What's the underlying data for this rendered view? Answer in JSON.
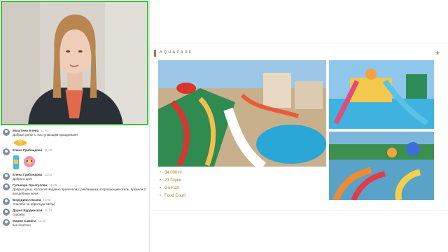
{
  "slide": {
    "title": "AQUAPARK",
    "bullets": [
      "34,000m²",
      "23 Горки",
      "Go-Kart",
      "Food Court"
    ]
  },
  "chat": {
    "messages": [
      {
        "author": "Мухутина Елена",
        "time": "11:01",
        "text": "Добрый день! С наступающим праздником!",
        "sticker": "sun"
      },
      {
        "author": "Елена Грибоедова",
        "time": "11:02",
        "text": "",
        "sticker": "flowers"
      },
      {
        "author": "Елена Грибоедова",
        "time": "11:02",
        "text": "Доброго дня!"
      },
      {
        "author": "Гульнара Оразгулова",
        "time": "11:05",
        "text": "Добрый день, коллеги! Недавно прилетели с рекламника потрясающий отель, провели 2 волшебные ночи"
      },
      {
        "author": "Бородина Оксана",
        "time": "11:06",
        "text": "Спасибо за обратную связь!"
      },
      {
        "author": "Дарья Бурдинская",
        "time": "11:21",
        "text": "спасибо"
      },
      {
        "author": "Мария Самина",
        "time": "11:22",
        "text": "все понятно"
      }
    ]
  },
  "colors": {
    "speaker_border": "#3ec13e",
    "accent_gold": "#a08a2a"
  }
}
